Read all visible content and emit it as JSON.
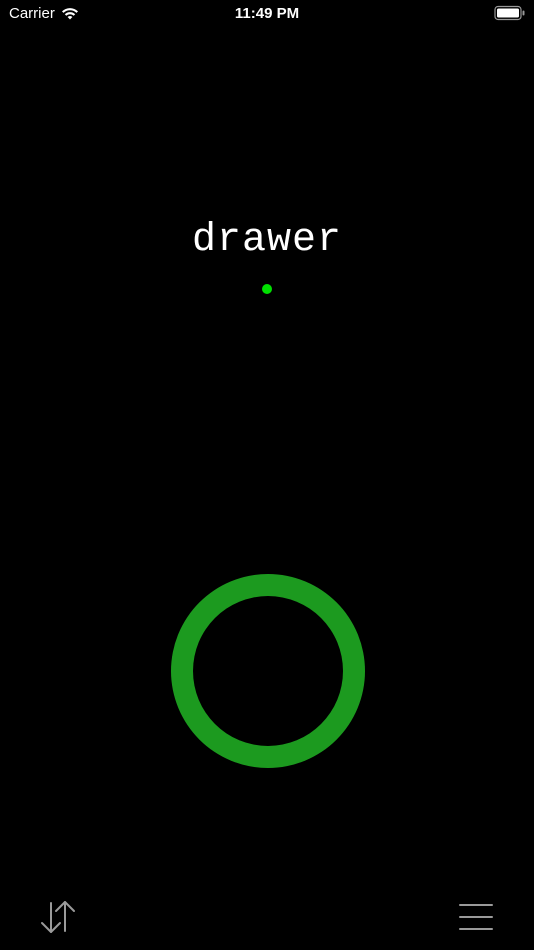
{
  "status_bar": {
    "carrier": "Carrier",
    "time": "11:49 PM"
  },
  "main": {
    "title": "drawer",
    "status_color": "#00e000",
    "ring_color": "#48c21a"
  },
  "toolbar": {
    "left_icon": "sort-arrows-icon",
    "right_icon": "menu-icon"
  }
}
